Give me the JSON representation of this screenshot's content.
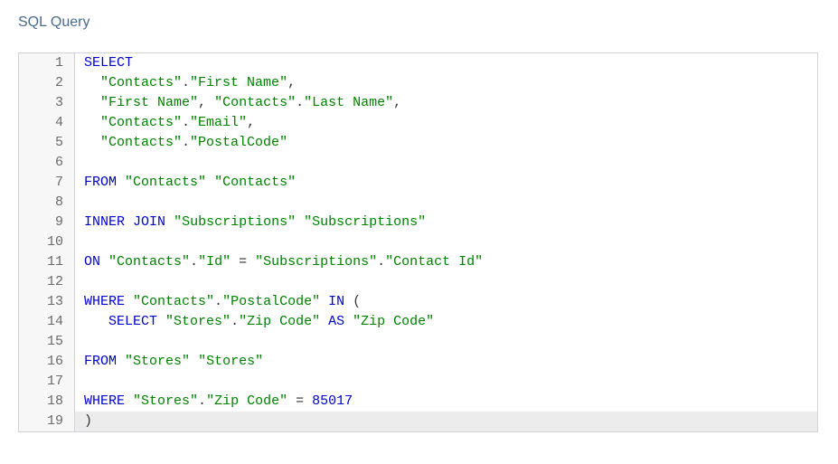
{
  "title": "SQL Query",
  "lines": {
    "l1": {
      "num": "1",
      "t1": "SELECT"
    },
    "l2": {
      "num": "2",
      "s1": "\"Contacts\"",
      "s2": "\"First Name\""
    },
    "l3": {
      "num": "3",
      "s1": "\"First Name\"",
      "s2": "\"Contacts\"",
      "s3": "\"Last Name\""
    },
    "l4": {
      "num": "4",
      "s1": "\"Contacts\"",
      "s2": "\"Email\""
    },
    "l5": {
      "num": "5",
      "s1": "\"Contacts\"",
      "s2": "\"PostalCode\""
    },
    "l6": {
      "num": "6"
    },
    "l7": {
      "num": "7",
      "k1": "FROM",
      "s1": "\"Contacts\"",
      "s2": "\"Contacts\""
    },
    "l8": {
      "num": "8"
    },
    "l9": {
      "num": "9",
      "k1": "INNER",
      "k2": "JOIN",
      "s1": "\"Subscriptions\"",
      "s2": "\"Subscriptions\""
    },
    "l10": {
      "num": "10"
    },
    "l11": {
      "num": "11",
      "k1": "ON",
      "s1": "\"Contacts\"",
      "s2": "\"Id\"",
      "s3": "\"Subscriptions\"",
      "s4": "\"Contact Id\""
    },
    "l12": {
      "num": "12"
    },
    "l13": {
      "num": "13",
      "k1": "WHERE",
      "s1": "\"Contacts\"",
      "s2": "\"PostalCode\"",
      "k2": "IN"
    },
    "l14": {
      "num": "14",
      "k1": "SELECT",
      "s1": "\"Stores\"",
      "s2": "\"Zip Code\"",
      "k2": "AS",
      "s3": "\"Zip Code\""
    },
    "l15": {
      "num": "15"
    },
    "l16": {
      "num": "16",
      "k1": "FROM",
      "s1": "\"Stores\"",
      "s2": "\"Stores\""
    },
    "l17": {
      "num": "17"
    },
    "l18": {
      "num": "18",
      "k1": "WHERE",
      "s1": "\"Stores\"",
      "s2": "\"Zip Code\"",
      "n1": "85017"
    },
    "l19": {
      "num": "19",
      "t1": ")"
    }
  }
}
